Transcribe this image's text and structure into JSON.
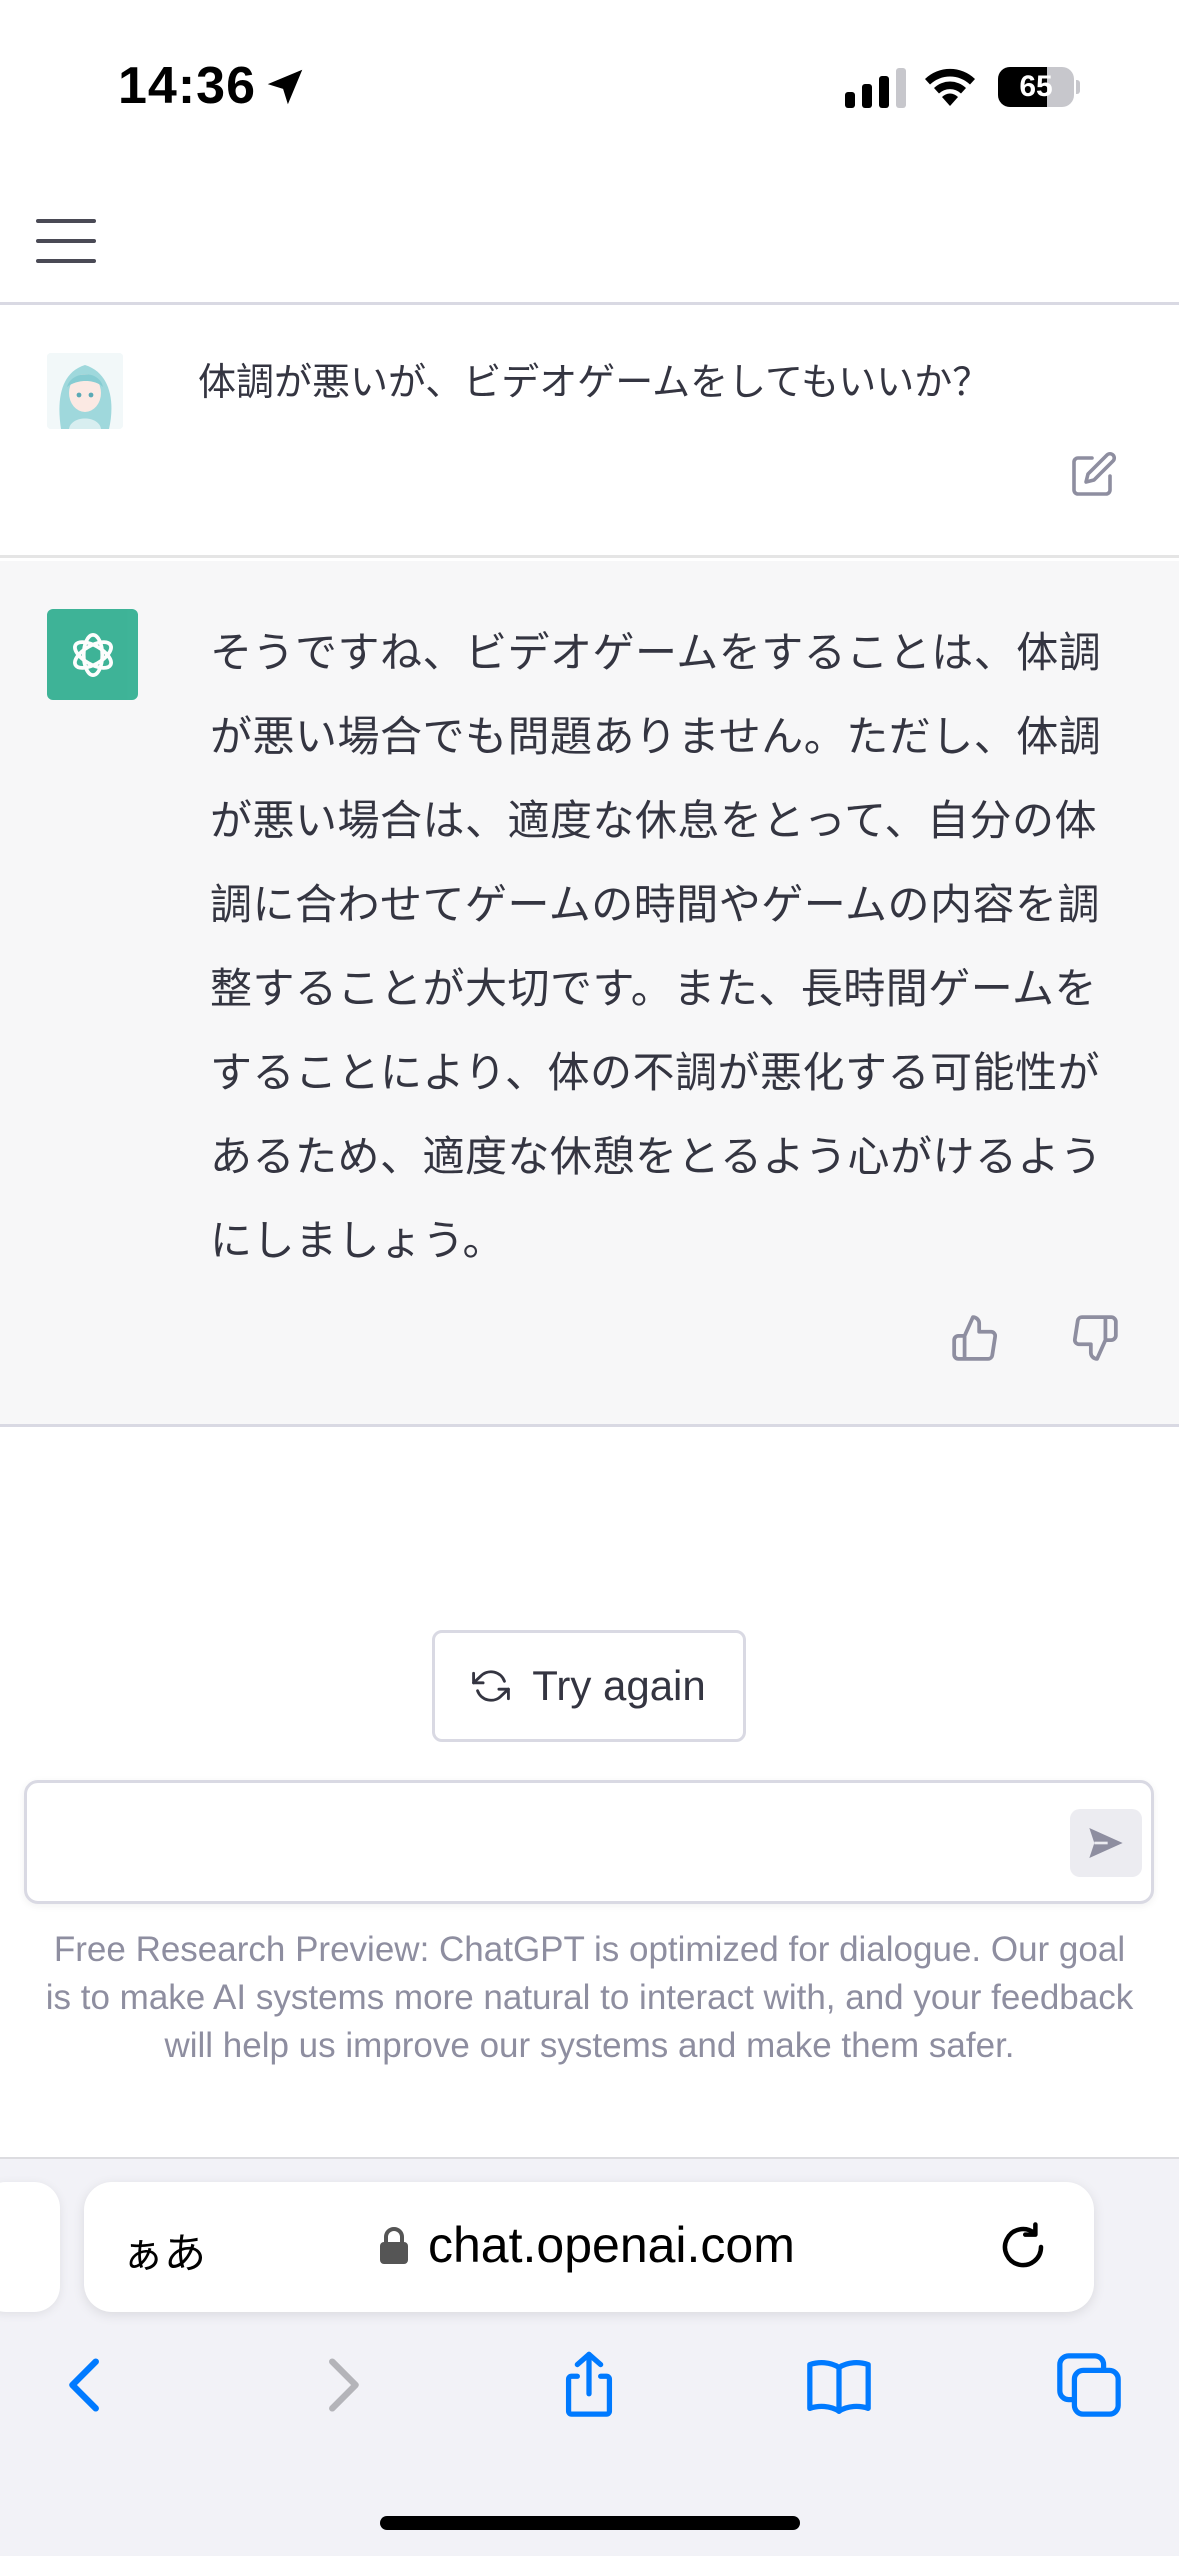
{
  "status_bar": {
    "time": "14:36",
    "battery_level": "65",
    "battery_fraction": 0.65,
    "icons": [
      "location-arrow-icon",
      "cellular-signal-icon",
      "wifi-icon",
      "battery-icon"
    ]
  },
  "nav": {
    "menu_icon": "hamburger-menu-icon"
  },
  "conversation": {
    "user_message": "体調が悪いが、ビデオゲームをしてもいいか？",
    "assistant_message": "そうですね、ビデオゲームをすることは、体調が悪い場合でも問題ありません。ただし、体調が悪い場合は、適度な休息をとって、自分の体調に合わせてゲームの時間やゲームの内容を調整することが大切です。また、長時間ゲームをすることにより、体の不調が悪化する可能性があるため、適度な休憩をとるよう心がけるようにしましょう。",
    "icons": {
      "edit": "edit-icon",
      "like": "thumbs-up-icon",
      "dislike": "thumbs-down-icon",
      "assistant_logo": "openai-logo-icon"
    }
  },
  "actions": {
    "try_again_label": "Try again"
  },
  "composer": {
    "value": "",
    "placeholder": ""
  },
  "disclaimer": "Free Research Preview: ChatGPT is optimized for dialogue. Our goal is to make AI systems more natural to interact with, and your feedback will help us improve our systems and make them safer.",
  "browser": {
    "text_size_label": "ぁあ",
    "url": "chat.openai.com",
    "toolbar_icons": [
      "back-icon",
      "forward-icon",
      "share-icon",
      "bookmarks-icon",
      "tabs-icon"
    ]
  },
  "colors": {
    "accent_blue": "#007aff",
    "openai_green": "#10a37f",
    "assistant_bg": "#f7f7f8",
    "text": "#343541",
    "muted": "#8e8ea0"
  }
}
